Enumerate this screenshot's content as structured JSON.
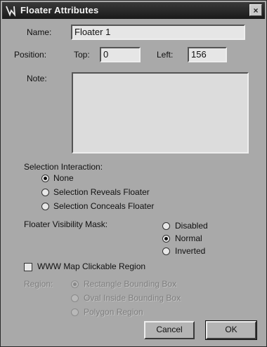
{
  "window": {
    "title": "Floater Attributes",
    "close_glyph": "×"
  },
  "name": {
    "label": "Name:",
    "value": "Floater 1"
  },
  "position": {
    "label": "Position:",
    "top_label": "Top:",
    "top_value": "0",
    "left_label": "Left:",
    "left_value": "156"
  },
  "note": {
    "label": "Note:",
    "value": ""
  },
  "selection_interaction": {
    "label": "Selection Interaction:",
    "options": [
      "None",
      "Selection Reveals Floater",
      "Selection Conceals Floater"
    ],
    "selected": "None"
  },
  "visibility_mask": {
    "label": "Floater Visibility Mask:",
    "options": [
      "Disabled",
      "Normal",
      "Inverted"
    ],
    "selected": "Normal"
  },
  "www_map": {
    "label": "WWW Map Clickable Region",
    "checked": false
  },
  "region": {
    "label": "Region:",
    "options": [
      "Rectangle Bounding Box",
      "Oval Inside Bounding Box",
      "Polygon Region"
    ],
    "selected": "Rectangle Bounding Box",
    "enabled": false
  },
  "buttons": {
    "cancel": "Cancel",
    "ok": "OK"
  }
}
